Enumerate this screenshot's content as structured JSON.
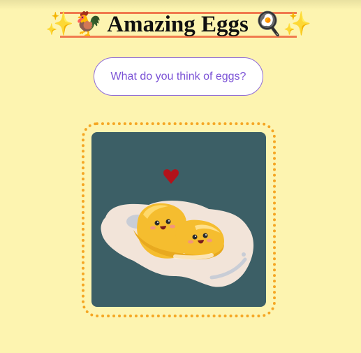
{
  "page": {
    "title": "✨🐓 Amazing Eggs 🍳✨",
    "ask_button_label": "What do you think of eggs?"
  },
  "illustration": {
    "subject": "two kawaii egg yolks on a fried egg white with a heart",
    "background_color": "#3c5f66"
  },
  "colors": {
    "page_background": "#fdf4b0",
    "title_border": "#f07a4e",
    "button_border": "#8f6bd8",
    "button_text": "#7b52d6",
    "frame_dots": "#f5a623"
  }
}
